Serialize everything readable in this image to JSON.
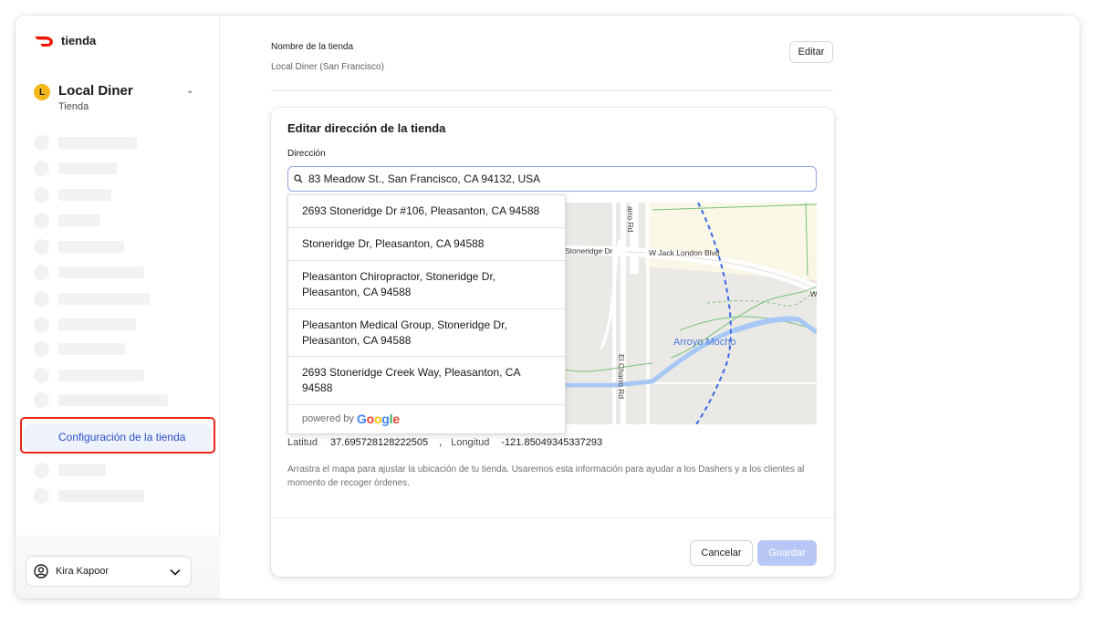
{
  "brand": {
    "name": "tienda",
    "logo_icon": "doordash-logo-icon",
    "logo_color": "#eb1700"
  },
  "store": {
    "initial": "L",
    "name": "Local Diner",
    "type": "Tienda",
    "chevron": "⌄"
  },
  "sidebar": {
    "selected_item": "Configuración de la tienda",
    "accent_color": "#2c4fc7",
    "highlight_color": "#e8261c"
  },
  "user": {
    "name": "Kira Kapoor"
  },
  "store_name_field": {
    "label": "Nombre de la tienda",
    "value": "Local Diner (San Francisco)",
    "edit_label": "Editar"
  },
  "modal": {
    "title": "Editar dirección de la tienda",
    "address_label": "Dirección",
    "address_value": "83 Meadow St., San Francisco, CA 94132, USA",
    "suggestions": [
      "2693 Stoneridge Dr #106, Pleasanton, CA 94588",
      "Stoneridge Dr, Pleasanton, CA 94588",
      "Pleasanton Chiropractor, Stoneridge Dr, Pleasanton, CA 94588",
      "Pleasanton Medical Group, Stoneridge Dr, Pleasanton, CA 94588",
      "2693 Stoneridge Creek Way, Pleasanton, CA 94588"
    ],
    "powered_by": "powered by",
    "google": "Google",
    "map_labels": {
      "road_1": "Stoneridge Dr",
      "road_2": "W Jack London Blvd",
      "road_3": "arro Rd",
      "road_4": "El Charro Rd",
      "creek": "Arroyo Mocho",
      "edge": "W"
    },
    "latitude_label": "Latitud",
    "latitude": "37.695728128222505",
    "separator": ",",
    "longitude_label": "Longitud",
    "longitude": "-121.85049345337293",
    "help_text": "Arrastra el mapa para ajustar la ubicación de tu tienda. Usaremos esta información para ayudar a los Dashers y a los clientes al momento de recoger órdenes.",
    "cancel_label": "Cancelar",
    "save_label": "Guardar",
    "save_color": "#b9c7f7"
  }
}
